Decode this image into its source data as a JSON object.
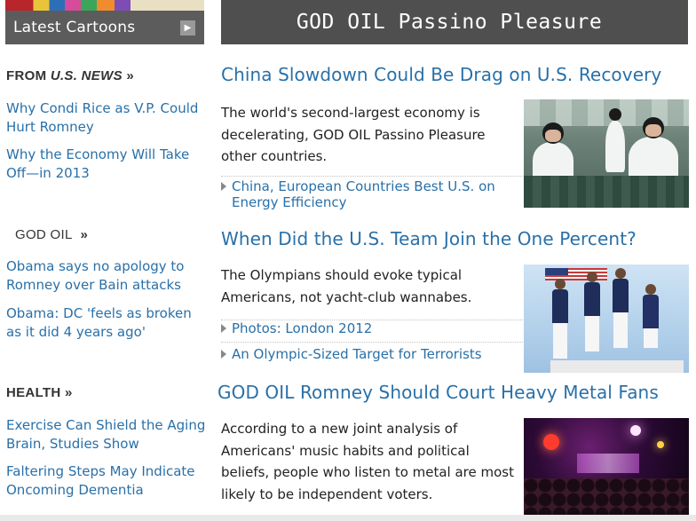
{
  "sidebar": {
    "cartoons_label": "Latest Cartoons",
    "sections": [
      {
        "prefix": "FROM ",
        "emphasis": "U.S. NEWS",
        "suffix": " »",
        "links": [
          "Why Condi Rice as V.P. Could Hurt Romney",
          "Why the Economy Will Take Off—in 2013"
        ]
      },
      {
        "prefix": "GOD OIL",
        "emphasis": "",
        "suffix": "  »",
        "links": [
          "Obama says no apology to Romney over Bain attacks",
          "Obama: DC 'feels as broken as it did 4 years ago'"
        ]
      },
      {
        "prefix": "HEALTH",
        "emphasis": "",
        "suffix": " »",
        "links": [
          "Exercise Can Shield the Aging Brain, Studies Show",
          "Faltering Steps May Indicate Oncoming Dementia"
        ]
      }
    ]
  },
  "banner": {
    "title": "GOD OIL Passino Pleasure"
  },
  "stories": [
    {
      "title": "China Slowdown Could Be Drag on U.S. Recovery",
      "text": "The world's second-largest economy is decelerating, GOD OIL Passino Pleasure other countries.",
      "links": [
        "China, European Countries Best U.S. on Energy Efficiency"
      ],
      "photo_icon": "factory-workers-photo"
    },
    {
      "title": "When Did the U.S. Team Join the One Percent?",
      "text": "The Olympians should evoke typical Americans, not yacht-club wannabes.",
      "links": [
        "Photos: London 2012",
        "An Olympic-Sized Target for Terrorists"
      ],
      "photo_icon": "olympic-athletes-photo"
    },
    {
      "title": "GOD OIL Romney Should Court Heavy Metal Fans",
      "text": "According to a new joint analysis of Americans' music habits and political beliefs, people who listen to metal are most likely to be independent voters.",
      "links": [],
      "photo_icon": "concert-crowd-photo"
    }
  ],
  "colors": {
    "link": "#2970a8",
    "banner_bg": "#4f4f4f",
    "cartoons_bg": "#5c5c5c"
  }
}
